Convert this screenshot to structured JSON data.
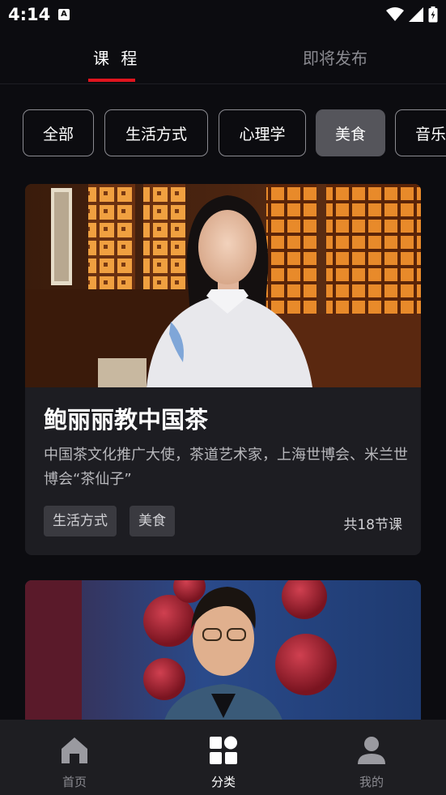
{
  "status_bar": {
    "time": "4:14",
    "notification_glyph": "A"
  },
  "top_tabs": [
    {
      "label": "课 程",
      "active": true
    },
    {
      "label": "即将发布",
      "active": false
    }
  ],
  "categories": [
    {
      "label": "全部",
      "selected": false
    },
    {
      "label": "生活方式",
      "selected": false
    },
    {
      "label": "心理学",
      "selected": false
    },
    {
      "label": "美食",
      "selected": true
    },
    {
      "label": "音乐",
      "selected": false
    }
  ],
  "courses": [
    {
      "title": "鲍丽丽教中国茶",
      "description": "中国茶文化推广大使，茶道艺术家，上海世博会、米兰世博会“茶仙子”",
      "tags": [
        "生活方式",
        "美食"
      ],
      "lesson_count": "共18节课"
    }
  ],
  "bottom_nav": [
    {
      "label": "首页",
      "icon": "home-icon",
      "active": false
    },
    {
      "label": "分类",
      "icon": "category-grid-icon",
      "active": true
    },
    {
      "label": "我的",
      "icon": "profile-icon",
      "active": false
    }
  ],
  "colors": {
    "background": "#0c0c10",
    "accent": "#e0141e",
    "card": "#1d1d22",
    "chip_selected": "#55555b",
    "bottom_nav": "#1e1e22"
  }
}
